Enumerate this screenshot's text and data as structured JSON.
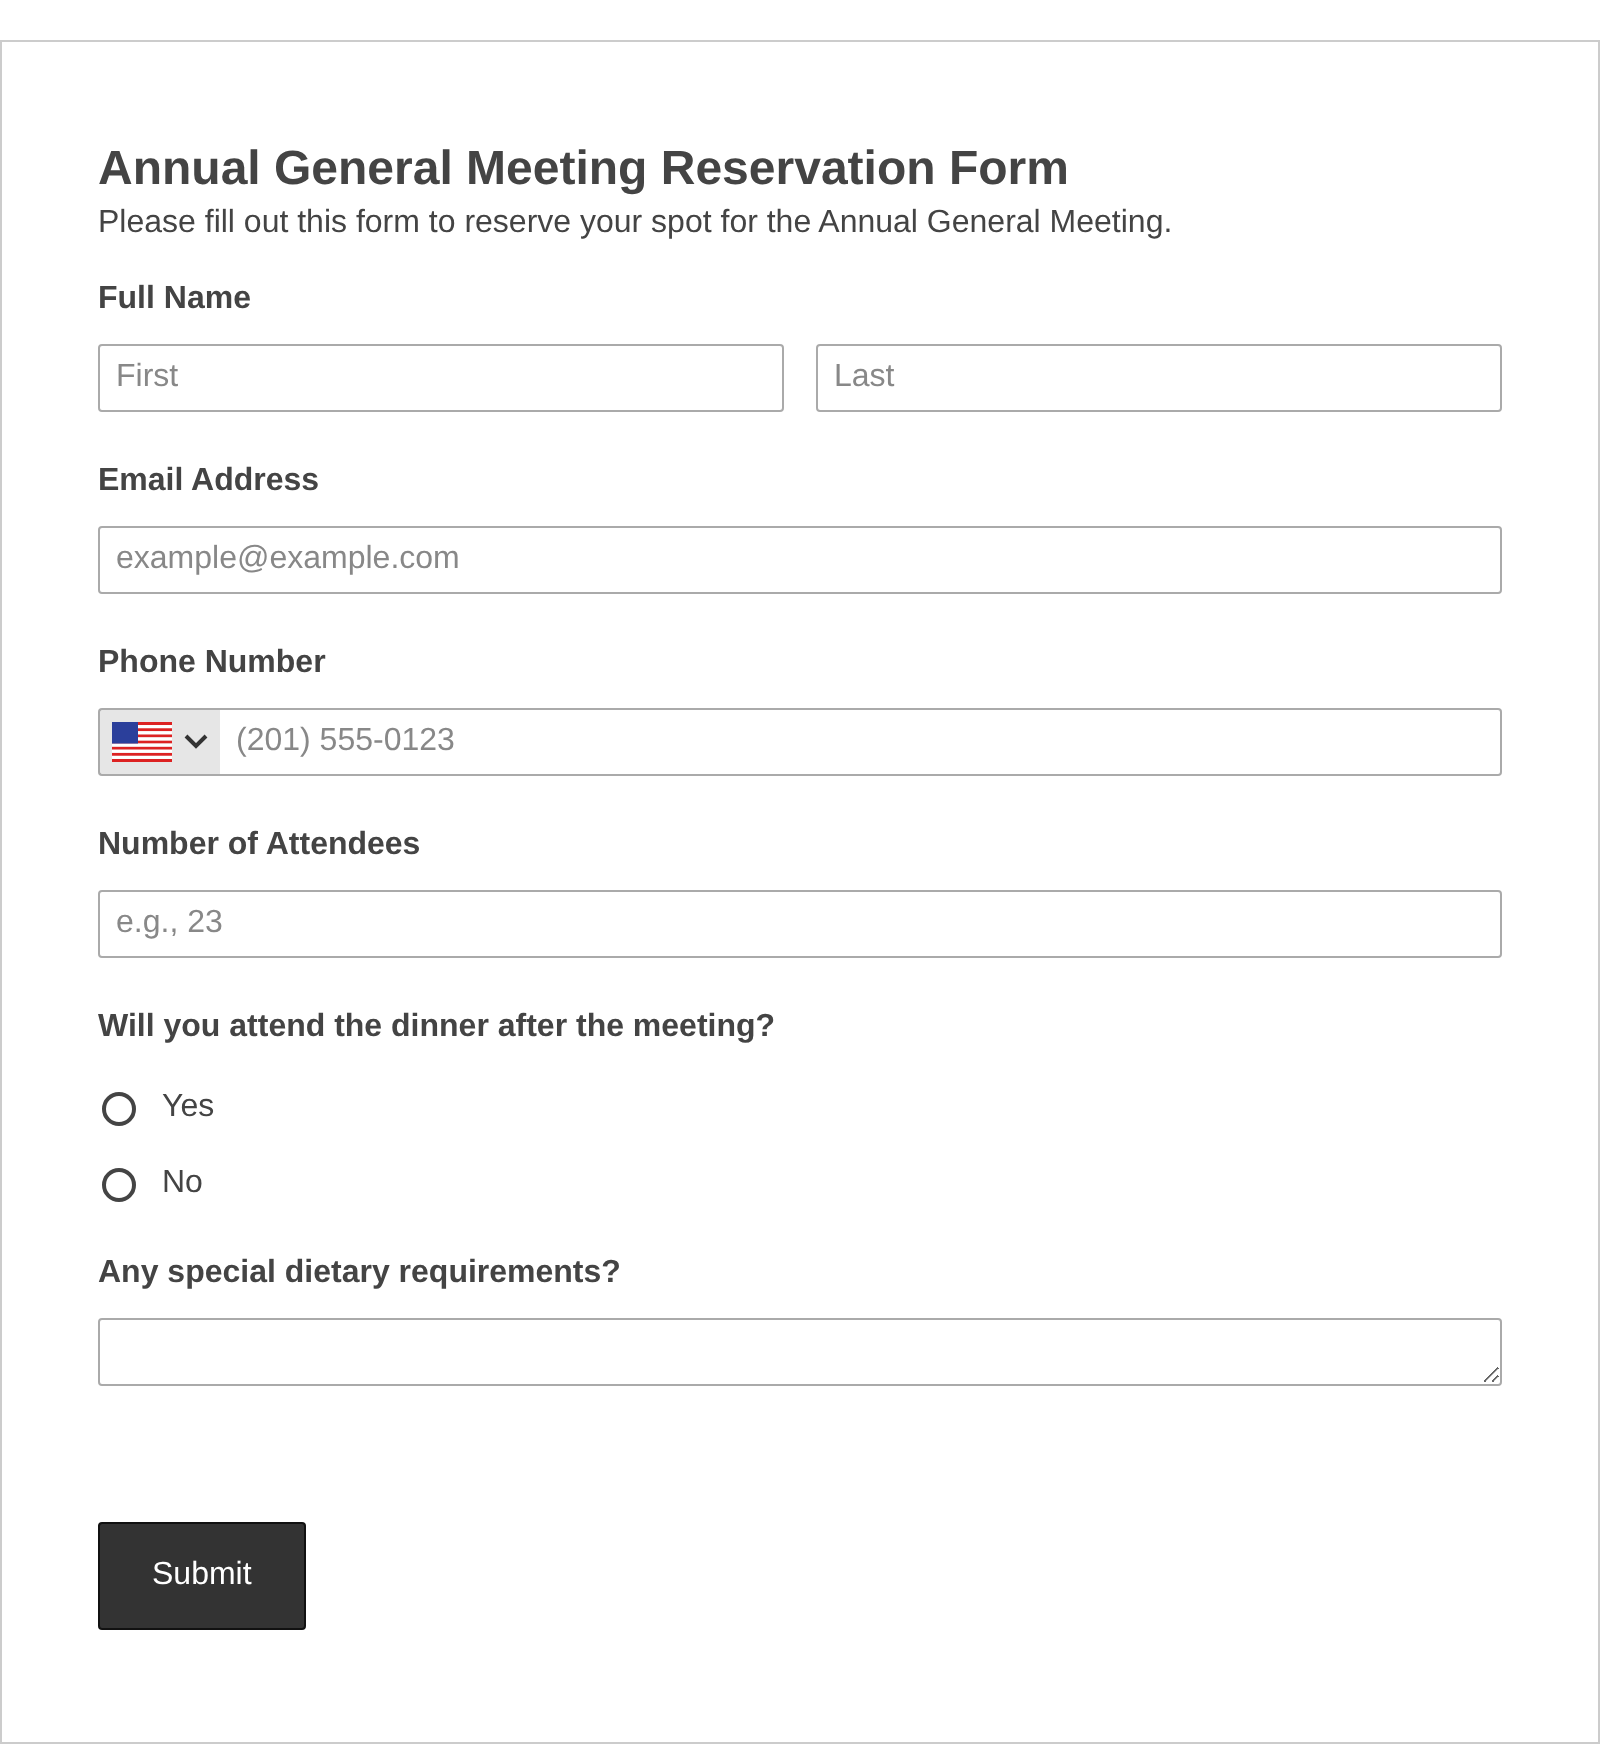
{
  "form": {
    "title": "Annual General Meeting Reservation Form",
    "description": "Please fill out this form to reserve your spot for the Annual General Meeting.",
    "fields": [
      {
        "kind": "name",
        "label": "Full Name",
        "inputs": [
          {
            "placeholder": "First"
          },
          {
            "placeholder": "Last"
          }
        ]
      },
      {
        "kind": "text",
        "label": "Email Address",
        "placeholder": "example@example.com"
      },
      {
        "kind": "phone",
        "label": "Phone Number",
        "placeholder": "(201) 555-0123"
      },
      {
        "kind": "text",
        "label": "Number of Attendees",
        "placeholder": "e.g., 23"
      },
      {
        "kind": "radio",
        "label": "Will you attend the dinner after the meeting?",
        "options": [
          {
            "label": "Yes",
            "selected": false
          },
          {
            "label": "No",
            "selected": false
          }
        ]
      },
      {
        "kind": "textarea",
        "label": "Any special dietary requirements?"
      }
    ],
    "submit": "Submit"
  }
}
